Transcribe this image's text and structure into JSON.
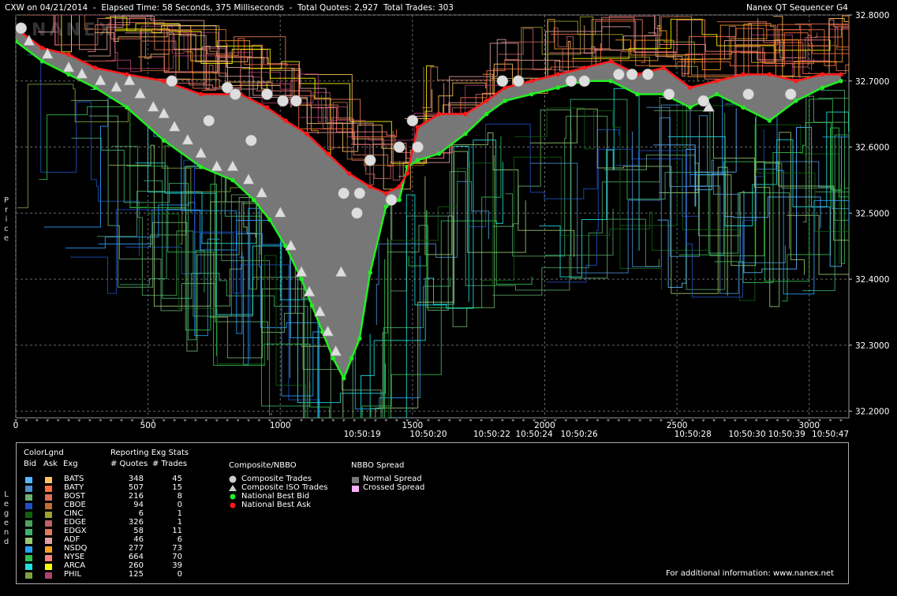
{
  "header": {
    "left": "CXW on 04/21/2014  -  Elapsed Time: 58 Seconds, 375 Milliseconds  -  Total Quotes: 2,927  Total Trades: 303",
    "right": "Nanex QT Sequencer G4"
  },
  "watermark": "NANEX",
  "side_labels": {
    "price": "Price",
    "legend": "Legend"
  },
  "chart_data": {
    "type": "line",
    "title": "CXW on 04/21/2014",
    "ylabel": "Price",
    "ylim": [
      32.19,
      32.8
    ],
    "xlim": [
      0,
      3150
    ],
    "y_ticks": [
      "32.8000",
      "32.7000",
      "32.6000",
      "32.5000",
      "32.4000",
      "32.3000",
      "32.2000"
    ],
    "x_ticks": [
      "0",
      "500",
      "1000",
      "1500",
      "2000",
      "2500",
      "3000"
    ],
    "x_time_labels": [
      {
        "x": 1310,
        "label": "10:50:19"
      },
      {
        "x": 1560,
        "label": "10:50:20"
      },
      {
        "x": 1800,
        "label": "10:50:22"
      },
      {
        "x": 1960,
        "label": "10:50:24"
      },
      {
        "x": 2130,
        "label": "10:50:26"
      },
      {
        "x": 2560,
        "label": "10:50:28"
      },
      {
        "x": 2765,
        "label": "10:50:30"
      },
      {
        "x": 2915,
        "label": "10:50:39"
      },
      {
        "x": 3080,
        "label": "10:50:47"
      }
    ],
    "grid": true,
    "series": [
      {
        "name": "National Best Ask",
        "color": "#ff1a1a",
        "x": [
          0,
          100,
          200,
          300,
          420,
          560,
          700,
          850,
          950,
          1020,
          1100,
          1180,
          1260,
          1340,
          1400,
          1450,
          1480,
          1520,
          1600,
          1700,
          1780,
          1850,
          1950,
          2050,
          2150,
          2250,
          2350,
          2450,
          2550,
          2650,
          2750,
          2850,
          2950,
          3050,
          3120
        ],
        "values": [
          32.78,
          32.75,
          32.74,
          32.72,
          32.71,
          32.7,
          32.68,
          32.68,
          32.66,
          32.64,
          32.62,
          32.59,
          32.56,
          32.54,
          32.53,
          32.54,
          32.56,
          32.63,
          32.65,
          32.65,
          32.67,
          32.69,
          32.7,
          32.71,
          32.72,
          32.73,
          32.71,
          32.72,
          32.69,
          32.7,
          32.71,
          32.71,
          32.7,
          32.71,
          32.71
        ]
      },
      {
        "name": "National Best Bid",
        "color": "#22ee22",
        "x": [
          0,
          100,
          200,
          300,
          420,
          560,
          700,
          820,
          900,
          960,
          1020,
          1080,
          1120,
          1160,
          1200,
          1240,
          1270,
          1300,
          1340,
          1400,
          1450,
          1480,
          1520,
          1600,
          1700,
          1780,
          1850,
          1950,
          2050,
          2150,
          2250,
          2350,
          2450,
          2550,
          2650,
          2750,
          2850,
          2950,
          3050,
          3120
        ],
        "values": [
          32.76,
          32.73,
          32.71,
          32.69,
          32.66,
          32.61,
          32.57,
          32.55,
          32.52,
          32.49,
          32.45,
          32.4,
          32.36,
          32.32,
          32.28,
          32.25,
          32.28,
          32.31,
          32.41,
          32.51,
          32.52,
          32.57,
          32.58,
          32.59,
          32.62,
          32.65,
          32.67,
          32.68,
          32.69,
          32.7,
          32.7,
          32.68,
          32.68,
          32.66,
          32.68,
          32.66,
          32.64,
          32.67,
          32.69,
          32.7
        ]
      }
    ],
    "composite_trades": [
      {
        "x": 20,
        "y": 32.78
      },
      {
        "x": 590,
        "y": 32.7
      },
      {
        "x": 730,
        "y": 32.64
      },
      {
        "x": 800,
        "y": 32.69
      },
      {
        "x": 830,
        "y": 32.68
      },
      {
        "x": 890,
        "y": 32.61
      },
      {
        "x": 950,
        "y": 32.68
      },
      {
        "x": 1010,
        "y": 32.67
      },
      {
        "x": 1060,
        "y": 32.67
      },
      {
        "x": 1240,
        "y": 32.53
      },
      {
        "x": 1290,
        "y": 32.5
      },
      {
        "x": 1300,
        "y": 32.53
      },
      {
        "x": 1340,
        "y": 32.58
      },
      {
        "x": 1420,
        "y": 32.52
      },
      {
        "x": 1450,
        "y": 32.6
      },
      {
        "x": 1500,
        "y": 32.64
      },
      {
        "x": 1520,
        "y": 32.6
      },
      {
        "x": 1840,
        "y": 32.7
      },
      {
        "x": 1900,
        "y": 32.7
      },
      {
        "x": 2100,
        "y": 32.7
      },
      {
        "x": 2150,
        "y": 32.7
      },
      {
        "x": 2280,
        "y": 32.71
      },
      {
        "x": 2330,
        "y": 32.71
      },
      {
        "x": 2390,
        "y": 32.71
      },
      {
        "x": 2470,
        "y": 32.68
      },
      {
        "x": 2600,
        "y": 32.67
      },
      {
        "x": 2770,
        "y": 32.68
      },
      {
        "x": 2930,
        "y": 32.68
      }
    ],
    "iso_trades": [
      {
        "x": 50,
        "y": 32.76
      },
      {
        "x": 120,
        "y": 32.74
      },
      {
        "x": 200,
        "y": 32.72
      },
      {
        "x": 250,
        "y": 32.71
      },
      {
        "x": 320,
        "y": 32.7
      },
      {
        "x": 380,
        "y": 32.69
      },
      {
        "x": 430,
        "y": 32.7
      },
      {
        "x": 470,
        "y": 32.68
      },
      {
        "x": 520,
        "y": 32.66
      },
      {
        "x": 560,
        "y": 32.65
      },
      {
        "x": 600,
        "y": 32.63
      },
      {
        "x": 650,
        "y": 32.61
      },
      {
        "x": 700,
        "y": 32.59
      },
      {
        "x": 760,
        "y": 32.57
      },
      {
        "x": 820,
        "y": 32.57
      },
      {
        "x": 880,
        "y": 32.55
      },
      {
        "x": 930,
        "y": 32.53
      },
      {
        "x": 1000,
        "y": 32.5
      },
      {
        "x": 1040,
        "y": 32.45
      },
      {
        "x": 1080,
        "y": 32.41
      },
      {
        "x": 1110,
        "y": 32.38
      },
      {
        "x": 1150,
        "y": 32.35
      },
      {
        "x": 1180,
        "y": 32.32
      },
      {
        "x": 1210,
        "y": 32.29
      },
      {
        "x": 1230,
        "y": 32.41
      },
      {
        "x": 2620,
        "y": 32.66
      }
    ],
    "legend": {
      "colorlgnd_title": "ColorLgnd",
      "stats_title": "Reporting Exg Stats",
      "col_bid": "Bid",
      "col_ask": "Ask",
      "col_exg": "Exg",
      "col_quotes": "# Quotes",
      "col_trades": "# Trades",
      "exchanges": [
        {
          "exg": "BATS",
          "quotes": "348",
          "trades": "45",
          "bid": "#5ab4ff",
          "ask": "#ffc060"
        },
        {
          "exg": "BATY",
          "quotes": "507",
          "trades": "15",
          "bid": "#4e8fcf",
          "ask": "#ff7040"
        },
        {
          "exg": "BOST",
          "quotes": "216",
          "trades": "8",
          "bid": "#6fae6f",
          "ask": "#e06f5a"
        },
        {
          "exg": "CBOE",
          "quotes": "94",
          "trades": "0",
          "bid": "#2050c0",
          "ask": "#c07030"
        },
        {
          "exg": "CINC",
          "quotes": "6",
          "trades": "1",
          "bid": "#106010",
          "ask": "#a0a030"
        },
        {
          "exg": "EDGE",
          "quotes": "326",
          "trades": "1",
          "bid": "#50a060",
          "ask": "#c06060"
        },
        {
          "exg": "EDGX",
          "quotes": "58",
          "trades": "11",
          "bid": "#40b070",
          "ask": "#e07a5a"
        },
        {
          "exg": "ADF",
          "quotes": "46",
          "trades": "6",
          "bid": "#98c870",
          "ask": "#e0a0a0"
        },
        {
          "exg": "NSDQ",
          "quotes": "277",
          "trades": "73",
          "bid": "#2aa0ff",
          "ask": "#ffa020"
        },
        {
          "exg": "NYSE",
          "quotes": "664",
          "trades": "70",
          "bid": "#30c050",
          "ask": "#ff8080"
        },
        {
          "exg": "ARCA",
          "quotes": "260",
          "trades": "39",
          "bid": "#20e0e0",
          "ask": "#ffff00"
        },
        {
          "exg": "PHIL",
          "quotes": "125",
          "trades": "0",
          "bid": "#80a040",
          "ask": "#b04070"
        }
      ],
      "composite_title": "Composite/NBBO",
      "composite_items": [
        "Composite Trades",
        "Composite ISO Trades",
        "National Best Bid",
        "National Best Ask"
      ],
      "spread_title": "NBBO Spread",
      "spread_items": [
        {
          "label": "Normal Spread",
          "color": "#777777"
        },
        {
          "label": "Crossed Spread",
          "color": "#ffb0ff"
        }
      ],
      "info": "For additional information: www.nanex.net"
    }
  }
}
